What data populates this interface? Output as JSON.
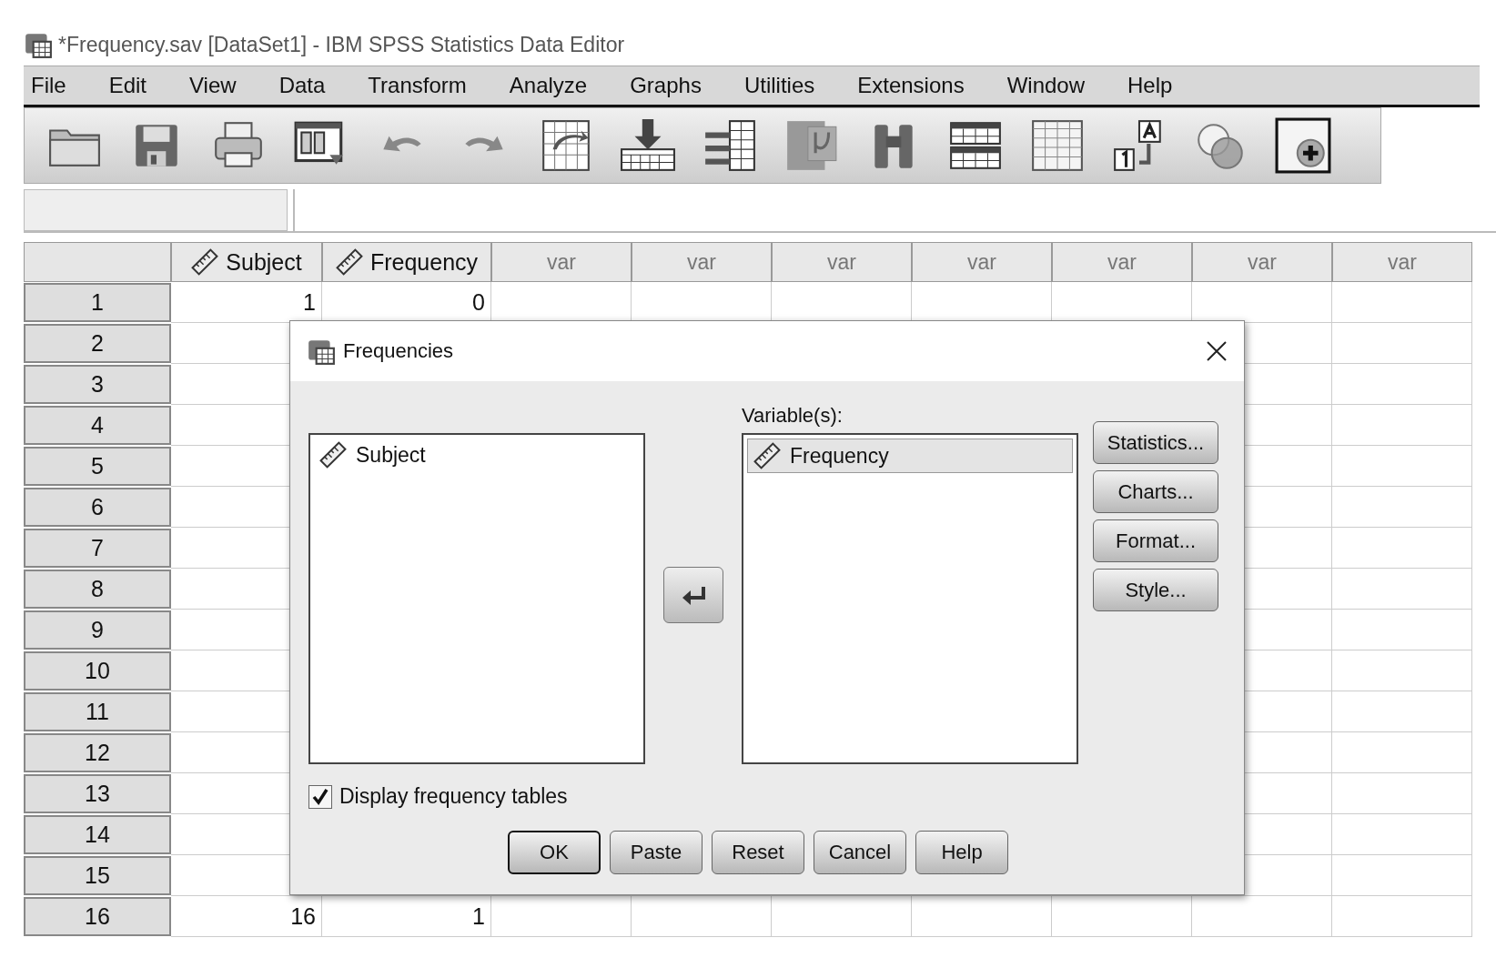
{
  "window": {
    "title": "*Frequency.sav [DataSet1] - IBM SPSS Statistics Data Editor"
  },
  "menu": [
    "File",
    "Edit",
    "View",
    "Data",
    "Transform",
    "Analyze",
    "Graphs",
    "Utilities",
    "Extensions",
    "Window",
    "Help"
  ],
  "grid": {
    "columns": [
      {
        "label": "Subject",
        "kind": "variable"
      },
      {
        "label": "Frequency",
        "kind": "variable"
      },
      {
        "label": "var",
        "kind": "empty"
      },
      {
        "label": "var",
        "kind": "empty"
      },
      {
        "label": "var",
        "kind": "empty"
      },
      {
        "label": "var",
        "kind": "empty"
      },
      {
        "label": "var",
        "kind": "empty"
      },
      {
        "label": "var",
        "kind": "empty"
      },
      {
        "label": "var",
        "kind": "empty"
      }
    ],
    "rows": [
      {
        "number": "1",
        "values": [
          "1",
          "0"
        ]
      },
      {
        "number": "2"
      },
      {
        "number": "3"
      },
      {
        "number": "4"
      },
      {
        "number": "5"
      },
      {
        "number": "6"
      },
      {
        "number": "7"
      },
      {
        "number": "8"
      },
      {
        "number": "9"
      },
      {
        "number": "10"
      },
      {
        "number": "11"
      },
      {
        "number": "12"
      },
      {
        "number": "13"
      },
      {
        "number": "14"
      },
      {
        "number": "15"
      },
      {
        "number": "16",
        "values": [
          "16",
          "1"
        ]
      }
    ]
  },
  "dialog": {
    "title": "Frequencies",
    "source_list": [
      {
        "label": "Subject",
        "selected": false
      }
    ],
    "target_label": "Variable(s):",
    "target_list": [
      {
        "label": "Frequency",
        "selected": true
      }
    ],
    "side_buttons": [
      "Statistics...",
      "Charts...",
      "Format...",
      "Style..."
    ],
    "checkbox": {
      "label": "Display frequency tables",
      "checked": true
    },
    "buttons": [
      {
        "label": "OK",
        "default": true
      },
      {
        "label": "Paste",
        "default": false
      },
      {
        "label": "Reset",
        "default": false
      },
      {
        "label": "Cancel",
        "default": false
      },
      {
        "label": "Help",
        "default": false
      }
    ]
  }
}
